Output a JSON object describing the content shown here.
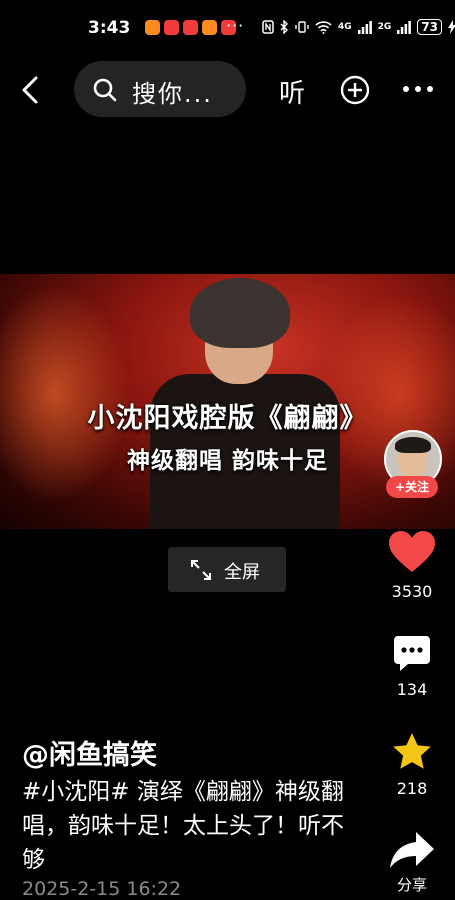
{
  "status_bar": {
    "time": "3:43",
    "more_dots": "···",
    "network_a": "4G",
    "network_b": "2G",
    "battery": "73"
  },
  "topbar": {
    "search_text": "搜你...",
    "listen_label": "听"
  },
  "video": {
    "caption_line1": "小沈阳戏腔版《翩翩》",
    "caption_line2": "神级翻唱  韵味十足"
  },
  "creator": {
    "follow_label": "+关注"
  },
  "fullscreen_label": "全屏",
  "actions": {
    "likes": "3530",
    "comments": "134",
    "favorites": "218",
    "share_label": "分享"
  },
  "post": {
    "author": "@闲鱼搞笑",
    "description": "#小沈阳# 演绎《翩翩》神级翻唱，韵味十足！太上头了！听不够",
    "date": "2025-2-15 16:22"
  },
  "colors": {
    "like": "#f24848",
    "favorite": "#f5c518",
    "search_bg": "#242424"
  }
}
